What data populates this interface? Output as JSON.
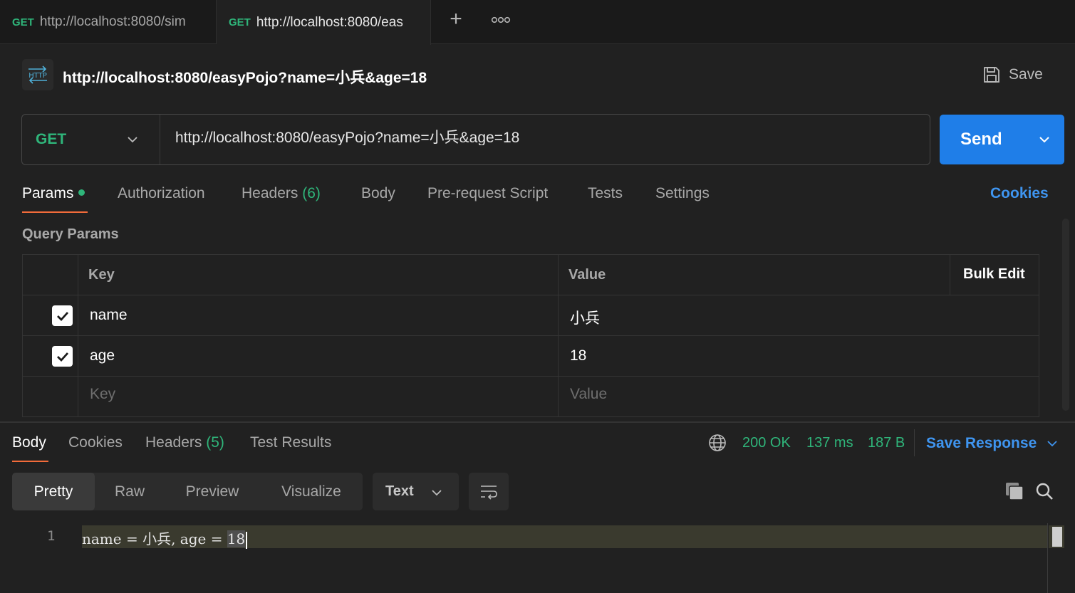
{
  "tabs": [
    {
      "method": "GET",
      "url": "http://localhost:8080/sim"
    },
    {
      "method": "GET",
      "url": "http://localhost:8080/eas"
    }
  ],
  "tab_actions": {
    "new_tab": "+",
    "more": "more-horizontal-icon"
  },
  "request": {
    "badge": "HTTP",
    "title": "http://localhost:8080/easyPojo?name=小兵&age=18",
    "save_label": "Save",
    "method": "GET",
    "url": "http://localhost:8080/easyPojo?name=小兵&age=18",
    "send_label": "Send"
  },
  "request_tabs": {
    "params": "Params",
    "authorization": "Authorization",
    "headers": "Headers",
    "headers_count": "(6)",
    "body": "Body",
    "prerequest": "Pre-request Script",
    "tests": "Tests",
    "settings": "Settings",
    "cookies": "Cookies"
  },
  "query_params": {
    "title": "Query Params",
    "col_key": "Key",
    "col_value": "Value",
    "bulk_edit": "Bulk Edit",
    "rows": [
      {
        "checked": true,
        "key": "name",
        "value": "小兵"
      },
      {
        "checked": true,
        "key": "age",
        "value": "18"
      }
    ],
    "placeholder_key": "Key",
    "placeholder_value": "Value"
  },
  "response_tabs": {
    "body": "Body",
    "cookies": "Cookies",
    "headers": "Headers",
    "headers_count": "(5)",
    "test_results": "Test Results"
  },
  "response_status": {
    "status": "200 OK",
    "time": "137 ms",
    "size": "187 B",
    "save_response": "Save Response"
  },
  "view_modes": {
    "pretty": "Pretty",
    "raw": "Raw",
    "preview": "Preview",
    "visualize": "Visualize",
    "format": "Text"
  },
  "code": {
    "line_number": "1",
    "prefix": "name = 小兵, age = ",
    "selected": "18"
  },
  "colors": {
    "accent_green": "#2fb57a",
    "send_blue": "#1f7ee8",
    "link_blue": "#3f95f0",
    "tab_underline": "#f26b3a"
  }
}
